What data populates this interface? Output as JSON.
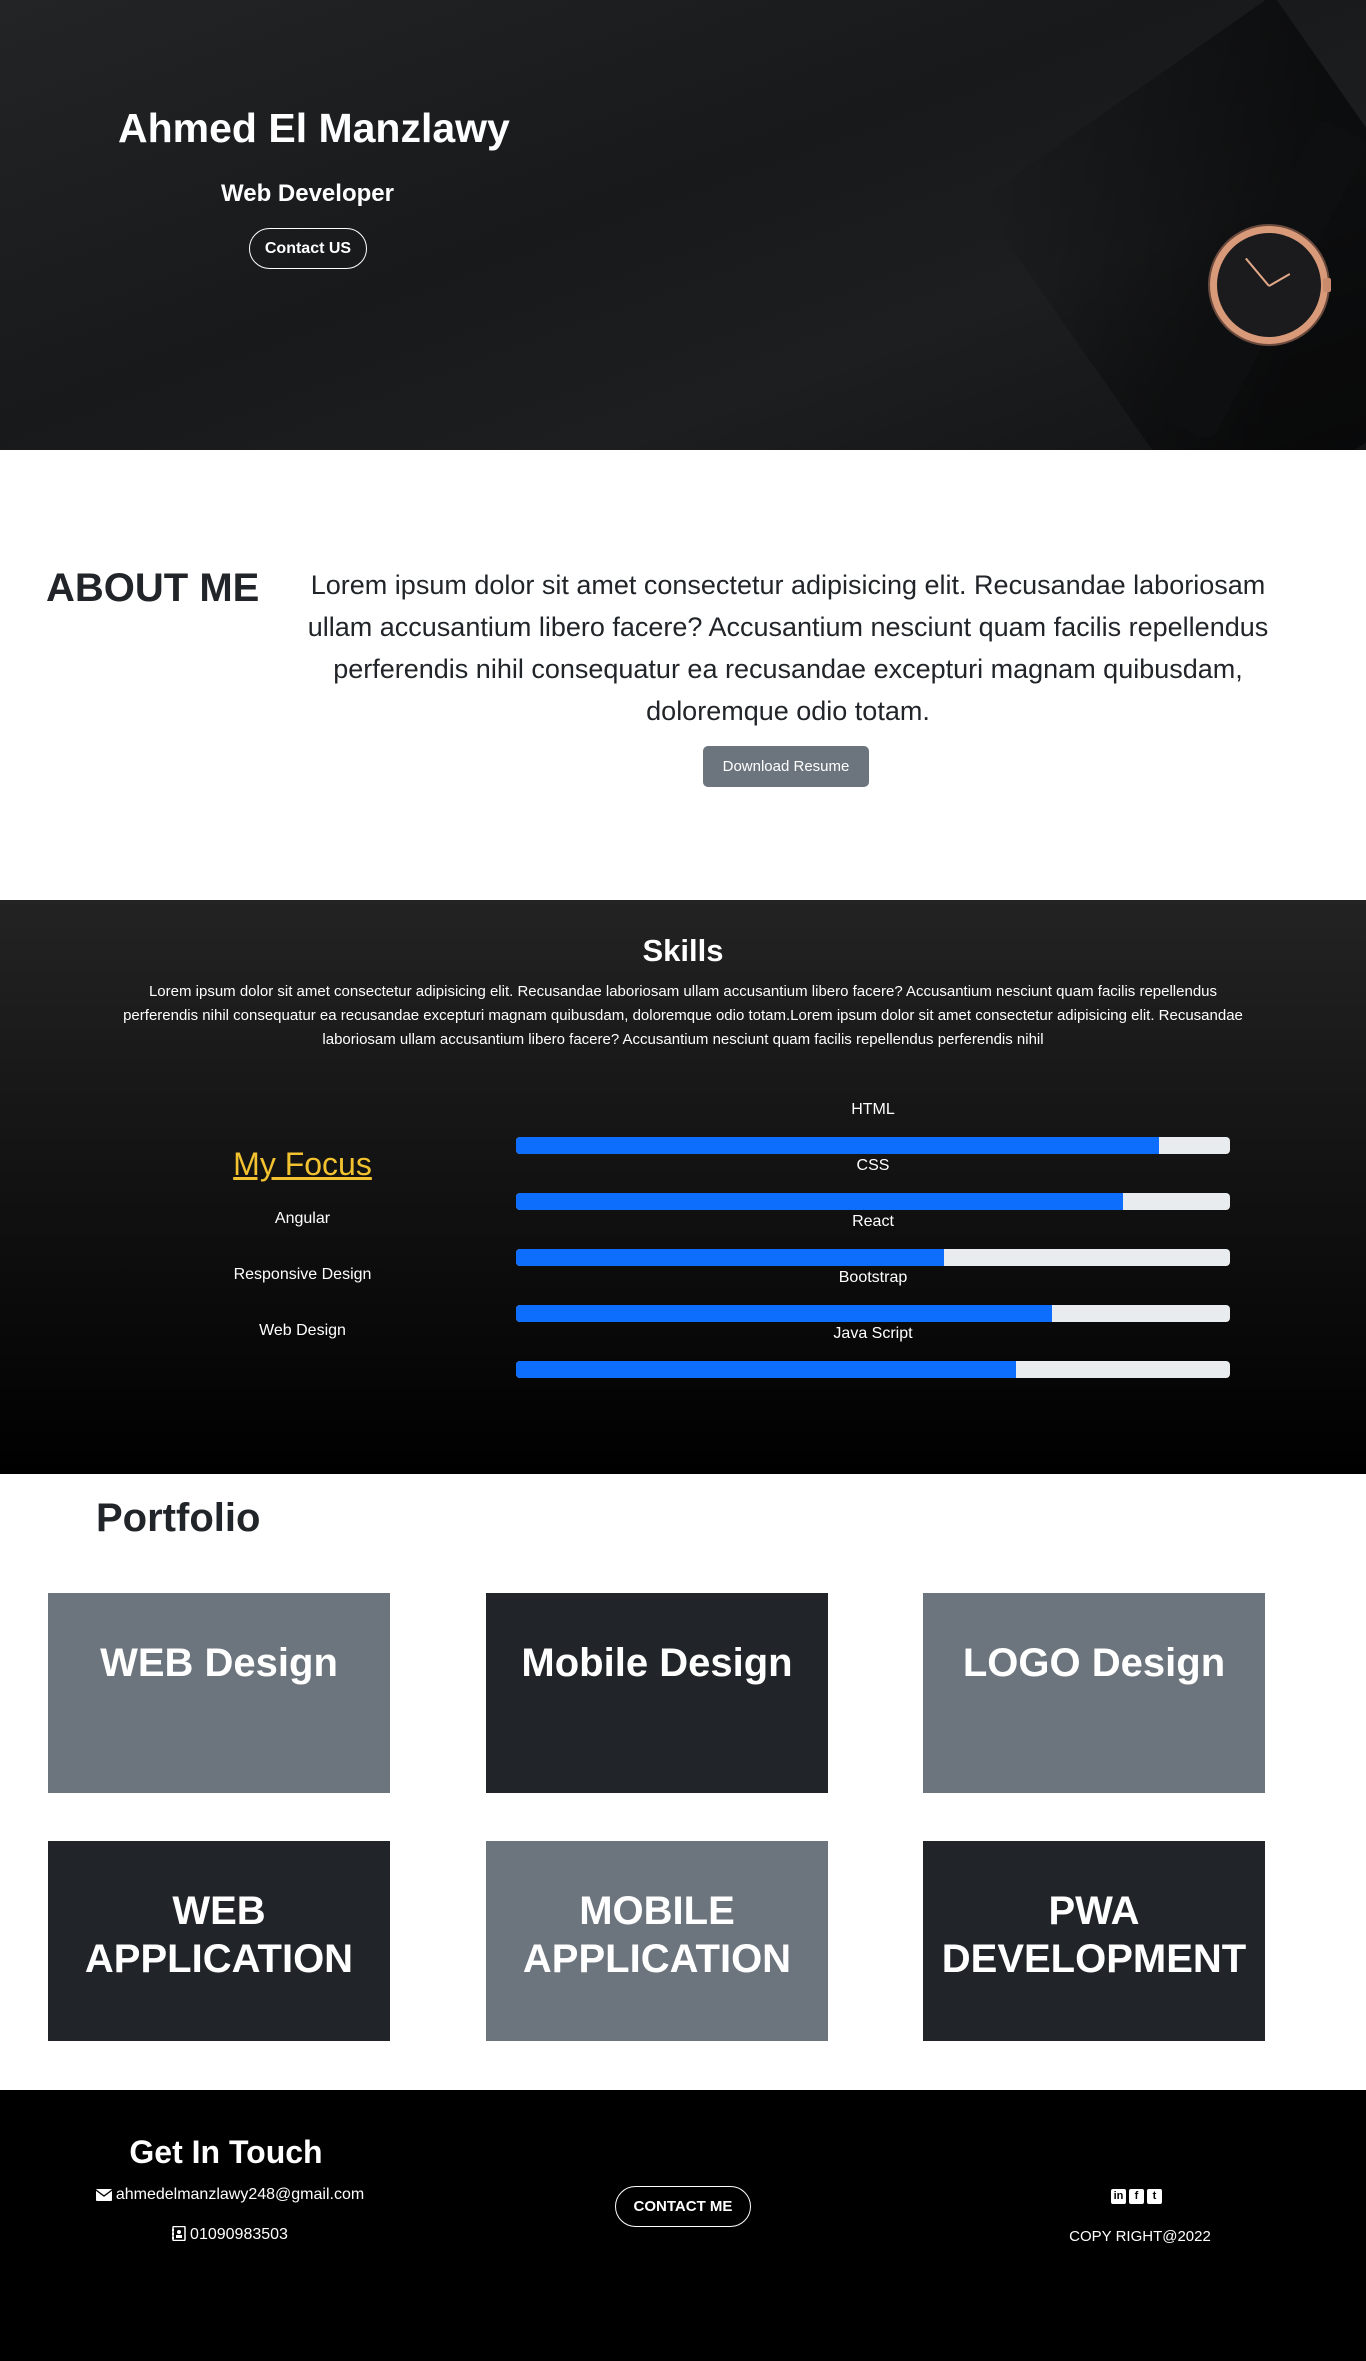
{
  "hero": {
    "name": "Ahmed El Manzlawy",
    "role": "Web Developer",
    "contact_label": "Contact US"
  },
  "about": {
    "title": "ABOUT ME",
    "text": "Lorem ipsum dolor sit amet consectetur adipisicing elit. Recusandae laboriosam ullam accusantium libero facere? Accusantium nesciunt quam facilis repellendus perferendis nihil consequatur ea recusandae excepturi magnam quibusdam, doloremque odio totam.",
    "download_label": "Download Resume"
  },
  "skills": {
    "title": "Skills",
    "description": "Lorem ipsum dolor sit amet consectetur adipisicing elit. Recusandae laboriosam ullam accusantium libero facere? Accusantium nesciunt quam facilis repellendus perferendis nihil consequatur ea recusandae excepturi magnam quibusdam, doloremque odio totam.Lorem ipsum dolor sit amet consectetur adipisicing elit. Recusandae laboriosam ullam accusantium libero facere? Accusantium nesciunt quam facilis repellendus perferendis nihil",
    "focus_title": "My Focus",
    "focus_items": [
      "Angular",
      "Responsive Design",
      "Web Design"
    ],
    "bars": [
      {
        "label": "HTML",
        "percent": 90
      },
      {
        "label": "CSS",
        "percent": 85
      },
      {
        "label": "React",
        "percent": 60
      },
      {
        "label": "Bootstrap",
        "percent": 75
      },
      {
        "label": "Java Script",
        "percent": 70
      }
    ],
    "bar_color": "#0d6efd",
    "focus_color": "#f2c230"
  },
  "portfolio": {
    "title": "Portfolio",
    "cards": [
      {
        "label": "WEB Design",
        "style": "gray"
      },
      {
        "label": "Mobile Design",
        "style": "dark"
      },
      {
        "label": "LOGO Design",
        "style": "gray"
      },
      {
        "label": "WEB APPLICATION",
        "style": "dark"
      },
      {
        "label": "MOBILE APPLICATION",
        "style": "gray"
      },
      {
        "label": "PWA DEVELOPMENT",
        "style": "dark"
      }
    ]
  },
  "footer": {
    "title": "Get In Touch",
    "email": "ahmedelmanzlawy248@gmail.com",
    "email_icon": "envelope-icon",
    "phone": "01090983503",
    "phone_icon": "contact-card-icon",
    "contact_me_label": "CONTACT ME",
    "socials": [
      {
        "icon": "linkedin-icon",
        "glyph": "in"
      },
      {
        "icon": "facebook-icon",
        "glyph": "f"
      },
      {
        "icon": "twitter-icon",
        "glyph": "t"
      }
    ],
    "copyright": "COPY RIGHT@2022"
  }
}
